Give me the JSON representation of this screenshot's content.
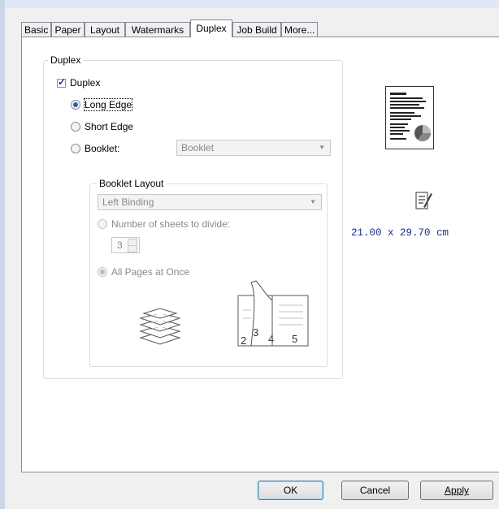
{
  "tabs": [
    {
      "label": "Basic"
    },
    {
      "label": "Paper"
    },
    {
      "label": "Layout"
    },
    {
      "label": "Watermarks"
    },
    {
      "label": "Duplex"
    },
    {
      "label": "Job Build"
    },
    {
      "label": "More..."
    }
  ],
  "active_tab": "Duplex",
  "duplex_group": {
    "title": "Duplex",
    "checkbox_label": "Duplex",
    "checked": true,
    "options": [
      {
        "label": "Long Edge",
        "selected": true
      },
      {
        "label": "Short Edge",
        "selected": false
      },
      {
        "label": "Booklet:",
        "selected": false
      }
    ],
    "booklet_select": {
      "value": "Booklet",
      "enabled": false
    }
  },
  "booklet_layout": {
    "title": "Booklet Layout",
    "binding_select": {
      "value": "Left Binding",
      "enabled": false
    },
    "divide_option": {
      "label": "Number of sheets to divide:",
      "selected": false,
      "enabled": false
    },
    "sheets_value": "3",
    "all_pages_option": {
      "label": "All Pages at Once",
      "selected": true,
      "enabled": false
    },
    "illustration_page_numbers": [
      "2",
      "3",
      "4",
      "5"
    ]
  },
  "preview": {
    "paper_size_text": "21.00 x 29.70 cm"
  },
  "buttons": {
    "ok": "OK",
    "cancel": "Cancel",
    "apply": "Apply"
  },
  "colors": {
    "size_text": "#1a2f86",
    "radio_selected": "#2a5fb3",
    "panel_border": "#898c95"
  }
}
